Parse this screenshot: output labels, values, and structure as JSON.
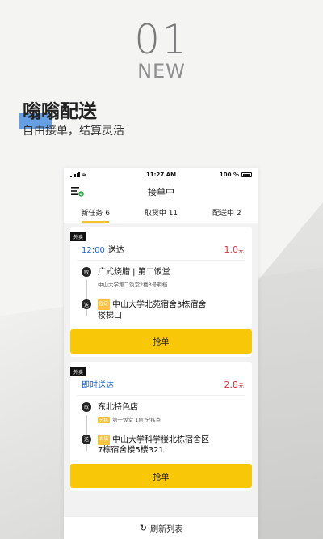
{
  "hero": {
    "number": "01",
    "word": "NEW"
  },
  "headline": "嗡嗡配送",
  "subhead": "自由接单，结算灵活",
  "status": {
    "time": "11:27 AM",
    "battery": "100 %"
  },
  "navbar": {
    "title": "接单中"
  },
  "tabs": [
    {
      "label": "新任务 6",
      "active": true
    },
    {
      "label": "取货中 11",
      "active": false
    },
    {
      "label": "配送中 2",
      "active": false
    }
  ],
  "orders": [
    {
      "tag": "外卖",
      "time": "12:00",
      "time_label": "送达",
      "price": "1.0",
      "price_unit": "元",
      "pickup_icon": "取",
      "pickup_name": "广式烧腊 | 第二饭堂",
      "pickup_tag": "",
      "pickup_addr": "中山大学第二饭堂2楼3号明档",
      "drop_icon": "送",
      "drop_tag": "固定",
      "drop_name_line1": "中山大学北苑宿舍3栋宿舍",
      "drop_name_line2": "楼梯口",
      "button": "抢单"
    },
    {
      "tag": "外卖",
      "time": "即时送达",
      "time_label": "",
      "price": "2.8",
      "price_unit": "元",
      "pickup_icon": "取",
      "pickup_name": "东北特色店",
      "pickup_tag": "分拣",
      "pickup_addr": "第一饭堂 1层 分拣点",
      "drop_icon": "送",
      "drop_tag": "自填",
      "drop_name_line1": "中山大学科学楼北栋宿舍区",
      "drop_name_line2": "7栋宿舍楼5楼321",
      "button": "抢单"
    }
  ],
  "refresh_label": "刷新列表",
  "colors": {
    "accent_yellow": "#f8c707",
    "price_red": "#e0303a",
    "time_blue": "#1a66c9",
    "accent_blue": "#4a8fe0"
  }
}
